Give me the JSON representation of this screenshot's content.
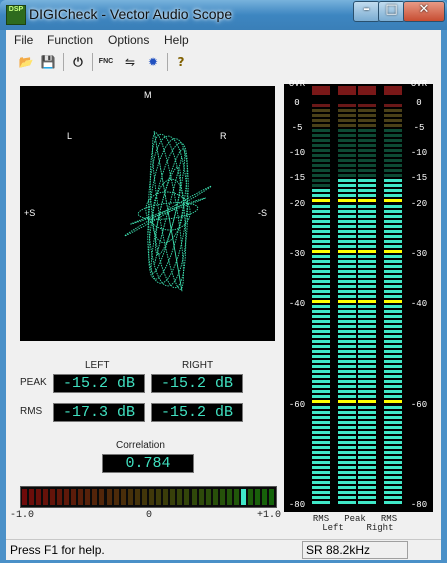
{
  "window": {
    "title": "DIGICheck - Vector Audio Scope",
    "app_icon_text": "DSP"
  },
  "menu": [
    "File",
    "Function",
    "Options",
    "Help"
  ],
  "toolbar": [
    {
      "icon": "open-folder-icon",
      "glyph": "📂"
    },
    {
      "icon": "save-disk-icon",
      "glyph": "💾"
    },
    {
      "icon": "power-icon",
      "glyph": "⏻"
    },
    {
      "icon": "function-icon",
      "glyph": "FNC"
    },
    {
      "icon": "settings-icon",
      "glyph": "⇋"
    },
    {
      "icon": "options-icon",
      "glyph": "✹"
    },
    {
      "icon": "help-icon",
      "glyph": "?"
    }
  ],
  "scope": {
    "top": "M",
    "left": "L",
    "right": "R",
    "plus_s": "+S",
    "minus_s": "-S"
  },
  "levels": {
    "left_header": "LEFT",
    "right_header": "RIGHT",
    "peak_label": "PEAK",
    "rms_label": "RMS",
    "peak_left": "-15.2 dB",
    "peak_right": "-15.2 dB",
    "rms_left": "-17.3 dB",
    "rms_right": "-15.2 dB"
  },
  "correlation": {
    "label": "Correlation",
    "value": "0.784",
    "value_num": 0.784,
    "scale_min": "-1.0",
    "scale_mid": "0",
    "scale_max": "+1.0"
  },
  "meters": {
    "scale": [
      "OVR",
      "0",
      "-5",
      "-10",
      "-15",
      "-20",
      "-30",
      "-40",
      "-60",
      "-80"
    ],
    "bottom_labels": [
      [
        "RMS",
        "Left"
      ],
      [
        "Peak",
        ""
      ],
      [
        "RMS",
        "Right"
      ]
    ],
    "bars": [
      {
        "name": "rms-left",
        "level_db": -17.3
      },
      {
        "name": "peak-left",
        "level_db": -15.2
      },
      {
        "name": "peak-right",
        "level_db": -15.2
      },
      {
        "name": "rms-right",
        "level_db": -15.2
      }
    ]
  },
  "status": {
    "help_text": "Press F1 for help.",
    "sample_rate": "SR 88.2kHz"
  },
  "colors": {
    "trace": "#3de0b0",
    "meter_lit": "#40e8c8",
    "meter_unlit": "#0d4a34",
    "marker": "#ffff00",
    "display_text": "#40e0c0"
  }
}
